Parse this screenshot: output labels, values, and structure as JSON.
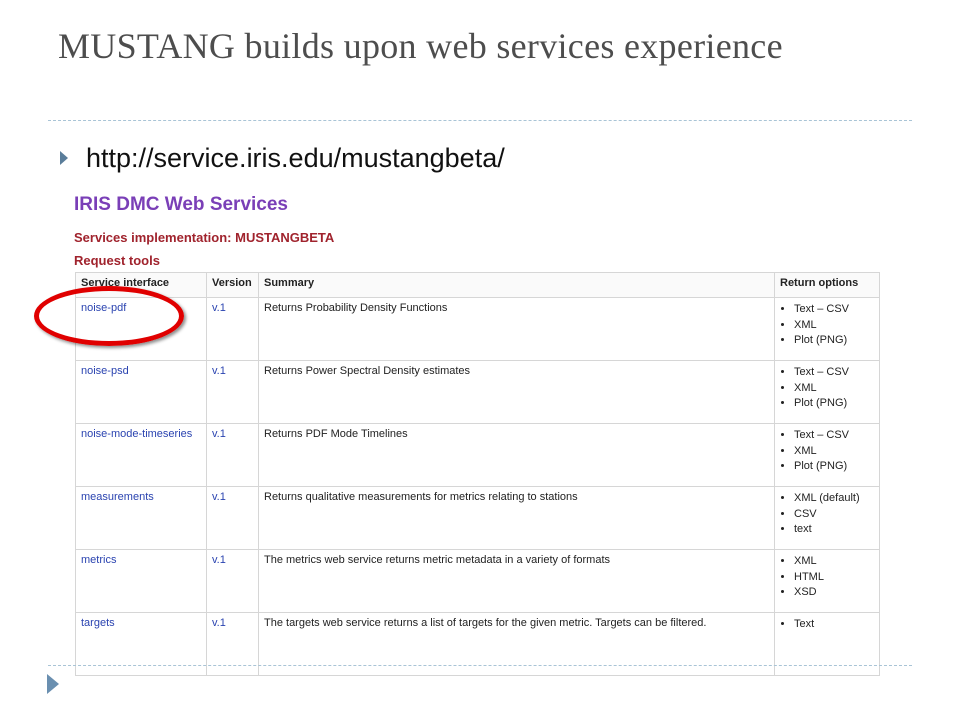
{
  "slide": {
    "title": "MUSTANG builds upon web services experience",
    "bullet_url": "http://service.iris.edu/mustangbeta/"
  },
  "screenshot": {
    "heading": "IRIS DMC Web Services",
    "subheading": "Services implementation: MUSTANGBETA",
    "section": "Request tools",
    "columns": [
      "Service interface",
      "Version",
      "Summary",
      "Return options"
    ],
    "rows": [
      {
        "service": "noise-pdf",
        "version": "v.1",
        "summary": "Returns Probability Density Functions",
        "options": [
          "Text – CSV",
          "XML",
          "Plot (PNG)"
        ]
      },
      {
        "service": "noise-psd",
        "version": "v.1",
        "summary": "Returns Power Spectral Density estimates",
        "options": [
          "Text – CSV",
          "XML",
          "Plot (PNG)"
        ]
      },
      {
        "service": "noise-mode-timeseries",
        "version": "v.1",
        "summary": "Returns PDF Mode Timelines",
        "options": [
          "Text – CSV",
          "XML",
          "Plot (PNG)"
        ]
      },
      {
        "service": "measurements",
        "version": "v.1",
        "summary": "Returns qualitative measurements for metrics relating to stations",
        "options": [
          "XML (default)",
          "CSV",
          "text"
        ]
      },
      {
        "service": "metrics",
        "version": "v.1",
        "summary": "The metrics web service returns metric metadata in a variety of formats",
        "options": [
          "XML",
          "HTML",
          "XSD"
        ]
      },
      {
        "service": "targets",
        "version": "v.1",
        "summary": "The targets web service returns a list of targets for the given metric. Targets can be filtered.",
        "options": [
          "Text"
        ]
      }
    ]
  },
  "colors": {
    "title_gray": "#4d4d4d",
    "heading_purple": "#7a3fb7",
    "subheading_red": "#a0232d",
    "link_blue": "#2a43b0",
    "highlight_red": "#e00000"
  }
}
